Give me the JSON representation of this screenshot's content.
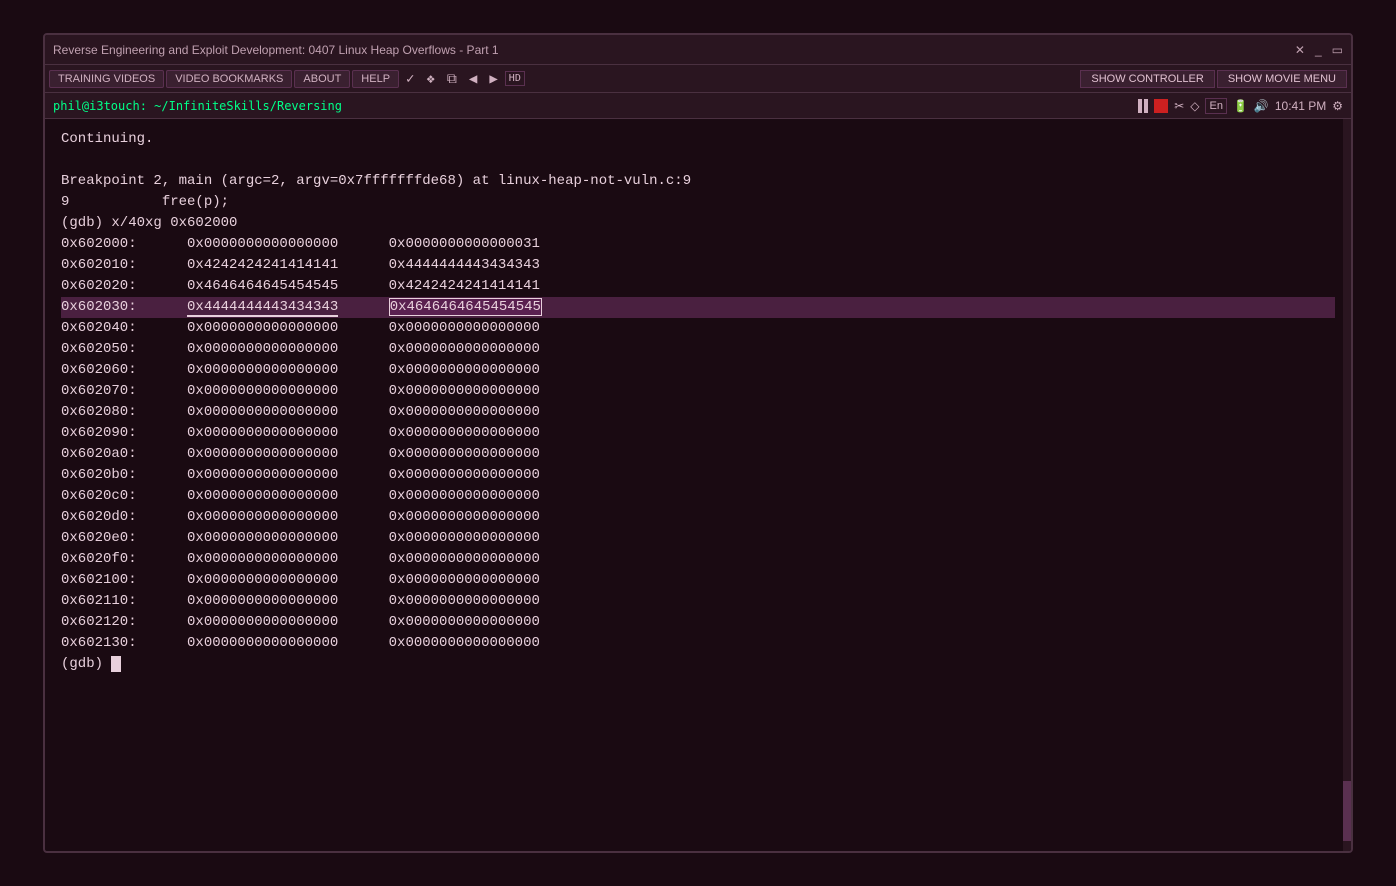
{
  "window": {
    "title": "Reverse Engineering and Exploit Development: 0407 Linux Heap Overflows - Part 1",
    "controls": "✕  _  ▭"
  },
  "menubar": {
    "items": [
      "TRAINING VIDEOS",
      "VIDEO BOOKMARKS",
      "ABOUT",
      "HELP"
    ],
    "icons": [
      "✓",
      "❖",
      "⧉",
      "◀",
      "▶",
      "HD"
    ],
    "right_buttons": [
      "SHOW CONTROLLER",
      "SHOW MOVIE MENU"
    ]
  },
  "systembar": {
    "path": "phil@i3touch: ~/InfiniteSkills/Reversing",
    "time": "10:41 PM"
  },
  "terminal": {
    "lines": [
      "Continuing.",
      "",
      "Breakpoint 2, main (argc=2, argv=0x7fffffffde68) at linux-heap-not-vuln.c:9",
      "9           free(p);",
      "(gdb) x/40xg 0x602000",
      "0x602000:\t0x0000000000000000\t0x0000000000000031",
      "0x602010:\t0x4242424241414141\t0x4444444443434343",
      "0x602020:\t0x4646464645454545\t0x4242424241414141",
      "0x602030:\t0x4444444443434343\t0x4646464645454545",
      "0x602040:\t0x0000000000000000\t0x0000000000000000",
      "0x602050:\t0x0000000000000000\t0x0000000000000000",
      "0x602060:\t0x0000000000000000\t0x0000000000000000",
      "0x602070:\t0x0000000000000000\t0x0000000000000000",
      "0x602080:\t0x0000000000000000\t0x0000000000000000",
      "0x602090:\t0x0000000000000000\t0x0000000000000000",
      "0x6020a0:\t0x0000000000000000\t0x0000000000000000",
      "0x6020b0:\t0x0000000000000000\t0x0000000000000000",
      "0x6020c0:\t0x0000000000000000\t0x0000000000000000",
      "0x6020d0:\t0x0000000000000000\t0x0000000000000000",
      "0x6020e0:\t0x0000000000000000\t0x0000000000000000",
      "0x6020f0:\t0x0000000000000000\t0x0000000000000000",
      "0x602100:\t0x0000000000000000\t0x0000000000000000",
      "0x602110:\t0x0000000000000000\t0x0000000000000000",
      "0x602120:\t0x0000000000000000\t0x0000000000000000",
      "0x602130:\t0x0000000000000000\t0x0000000000000000",
      "(gdb) "
    ],
    "highlight_line_index": 7,
    "cursor_line_index": 24,
    "cursor_col": 6
  },
  "colors": {
    "background": "#1a0a12",
    "titlebar_bg": "#2a1520",
    "terminal_text": "#e8d0dc",
    "highlight_bg": "#4a2040",
    "accent": "#00ff88",
    "border": "#4a3040"
  }
}
